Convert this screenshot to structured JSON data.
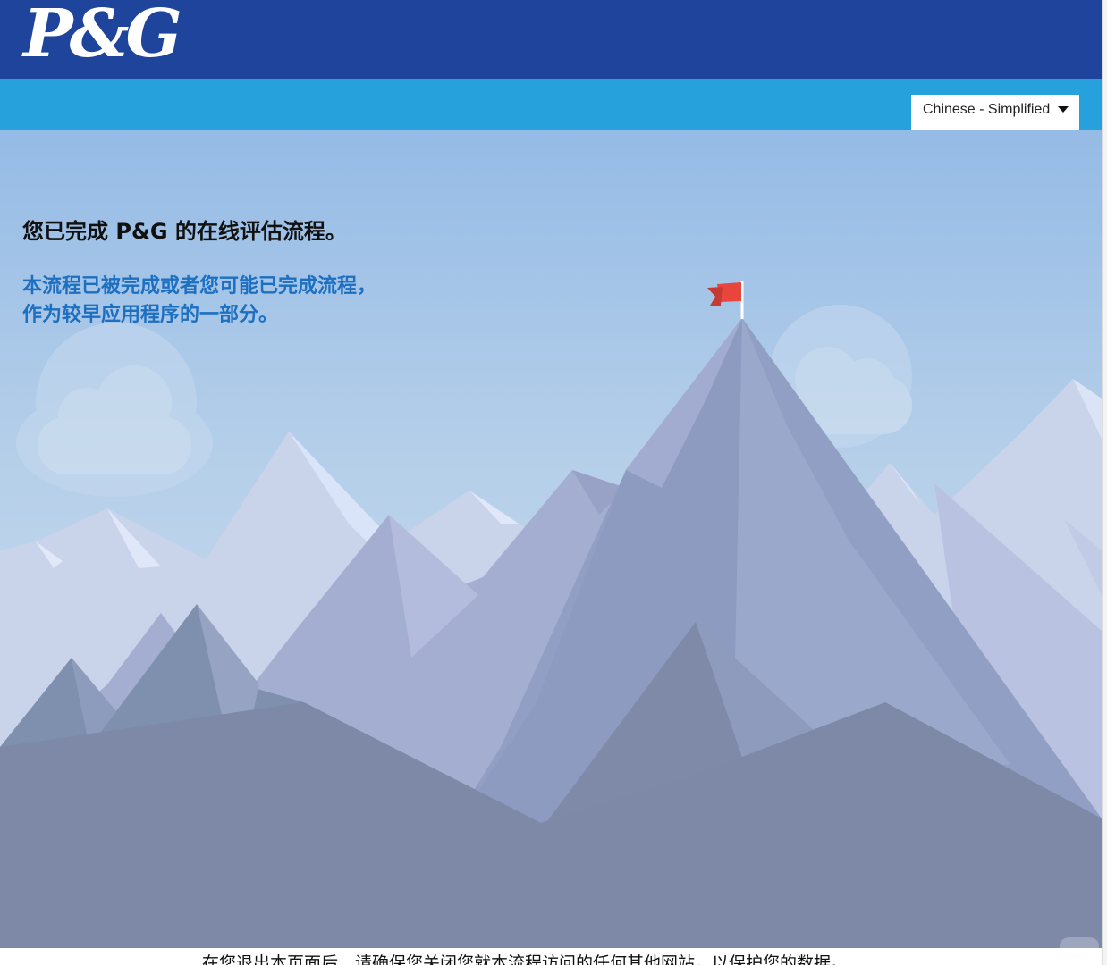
{
  "header": {
    "logo_text": "P&G",
    "brand_color": "#1f449b",
    "sub_bar_color": "#27a1dc"
  },
  "language_selector": {
    "selected": "Chinese - Simplified",
    "caret_icon": "caret-down-icon"
  },
  "main": {
    "title": "您已完成 P&G 的在线评估流程。",
    "message": "本流程已被完成或者您可能已完成流程，作为较早应用程序的一部分。",
    "flag_icon": "red-flag-icon"
  },
  "footer": {
    "notice": "在您退出本页面后，请确保您关闭您就本流程访问的任何其他网站，以保护您的数据。"
  }
}
